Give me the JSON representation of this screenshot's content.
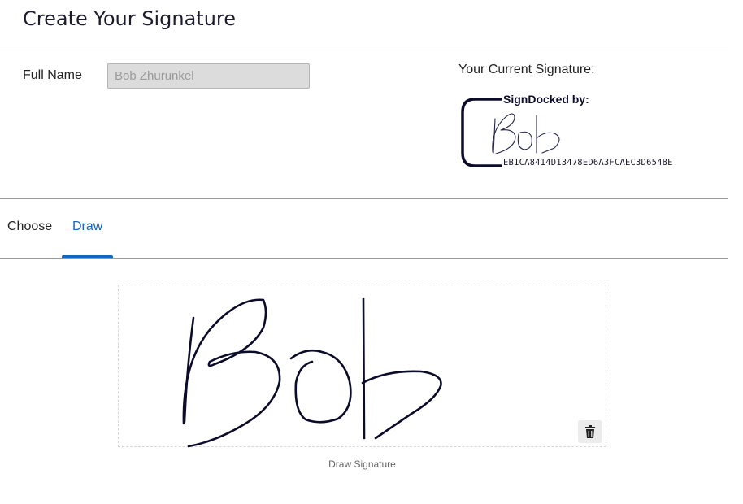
{
  "header": {
    "title": "Create Your Signature"
  },
  "form": {
    "full_name_label": "Full Name",
    "full_name_value": "Bob Zhurunkel"
  },
  "current_signature": {
    "label": "Your Current Signature:",
    "signed_by": "SignDocked by:",
    "hash": "EB1CA8414D13478ED6A3FCAEC3D6548E"
  },
  "tabs": [
    {
      "label": "Choose",
      "active": false
    },
    {
      "label": "Draw",
      "active": true
    }
  ],
  "draw": {
    "caption": "Draw Signature",
    "clear_icon": "trash-icon"
  },
  "colors": {
    "accent": "#1565c0",
    "ink": "#0b0b2a",
    "input_bg": "#dcdcdc"
  }
}
